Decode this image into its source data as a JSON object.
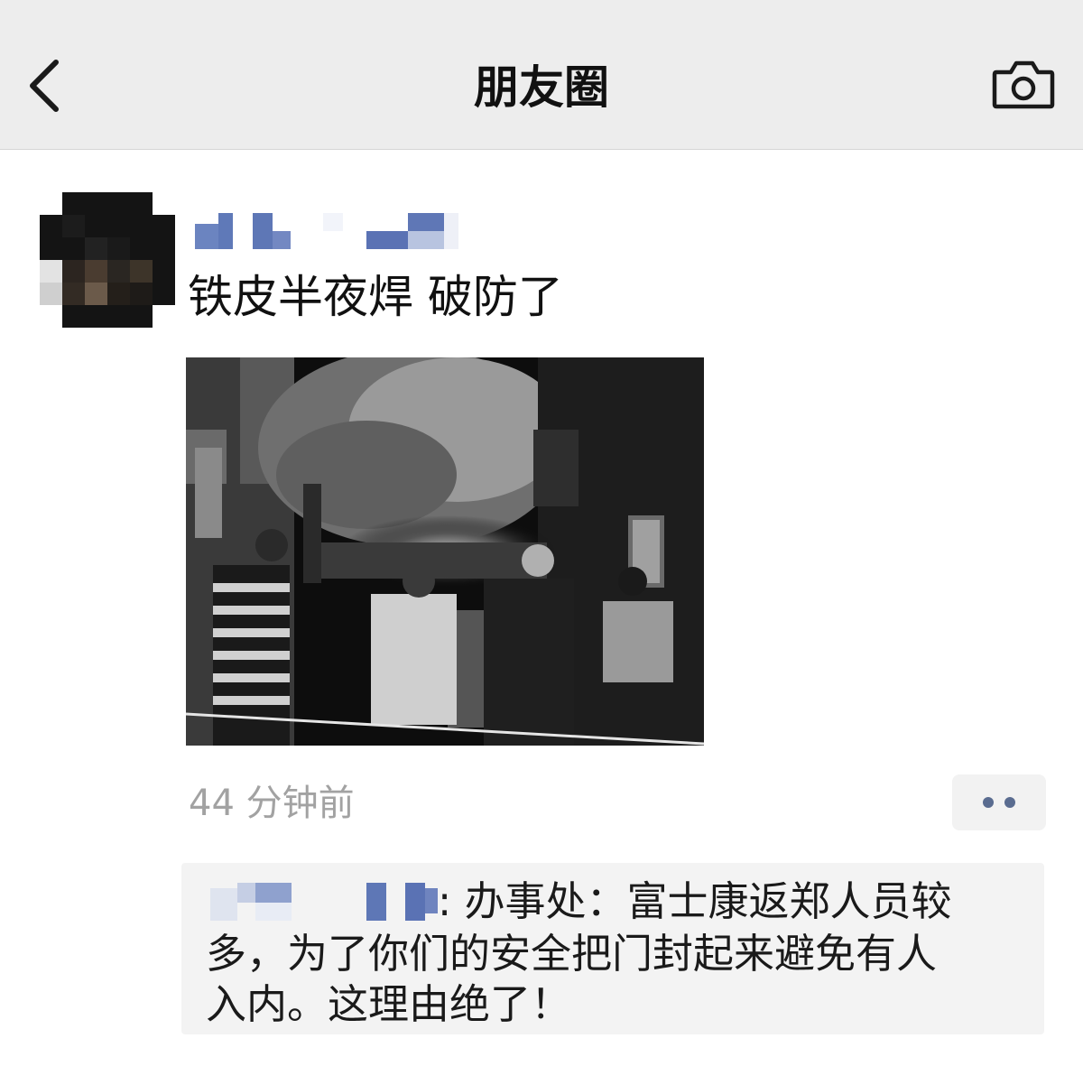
{
  "nav": {
    "title": "朋友圈",
    "back_icon": "chevron-left-icon",
    "camera_icon": "camera-icon"
  },
  "post": {
    "author_name": "(pixelated)",
    "text": "铁皮半夜焊 破防了",
    "photo_description": "black-and-white night photo",
    "timestamp": "44 分钟前",
    "more_icon": "more-dots-icon"
  },
  "comment": {
    "author_name": "(pixelated)",
    "line1": ": 办事处：富士康返郑人员较",
    "line2": "多，为了你们的安全把门封起来避免有人",
    "line3": "入内。这理由绝了！"
  },
  "colors": {
    "nav_bg": "#ededed",
    "link_blue": "#5a6c90",
    "timestamp_gray": "#a2a2a2",
    "comment_bg": "#f3f3f3"
  }
}
